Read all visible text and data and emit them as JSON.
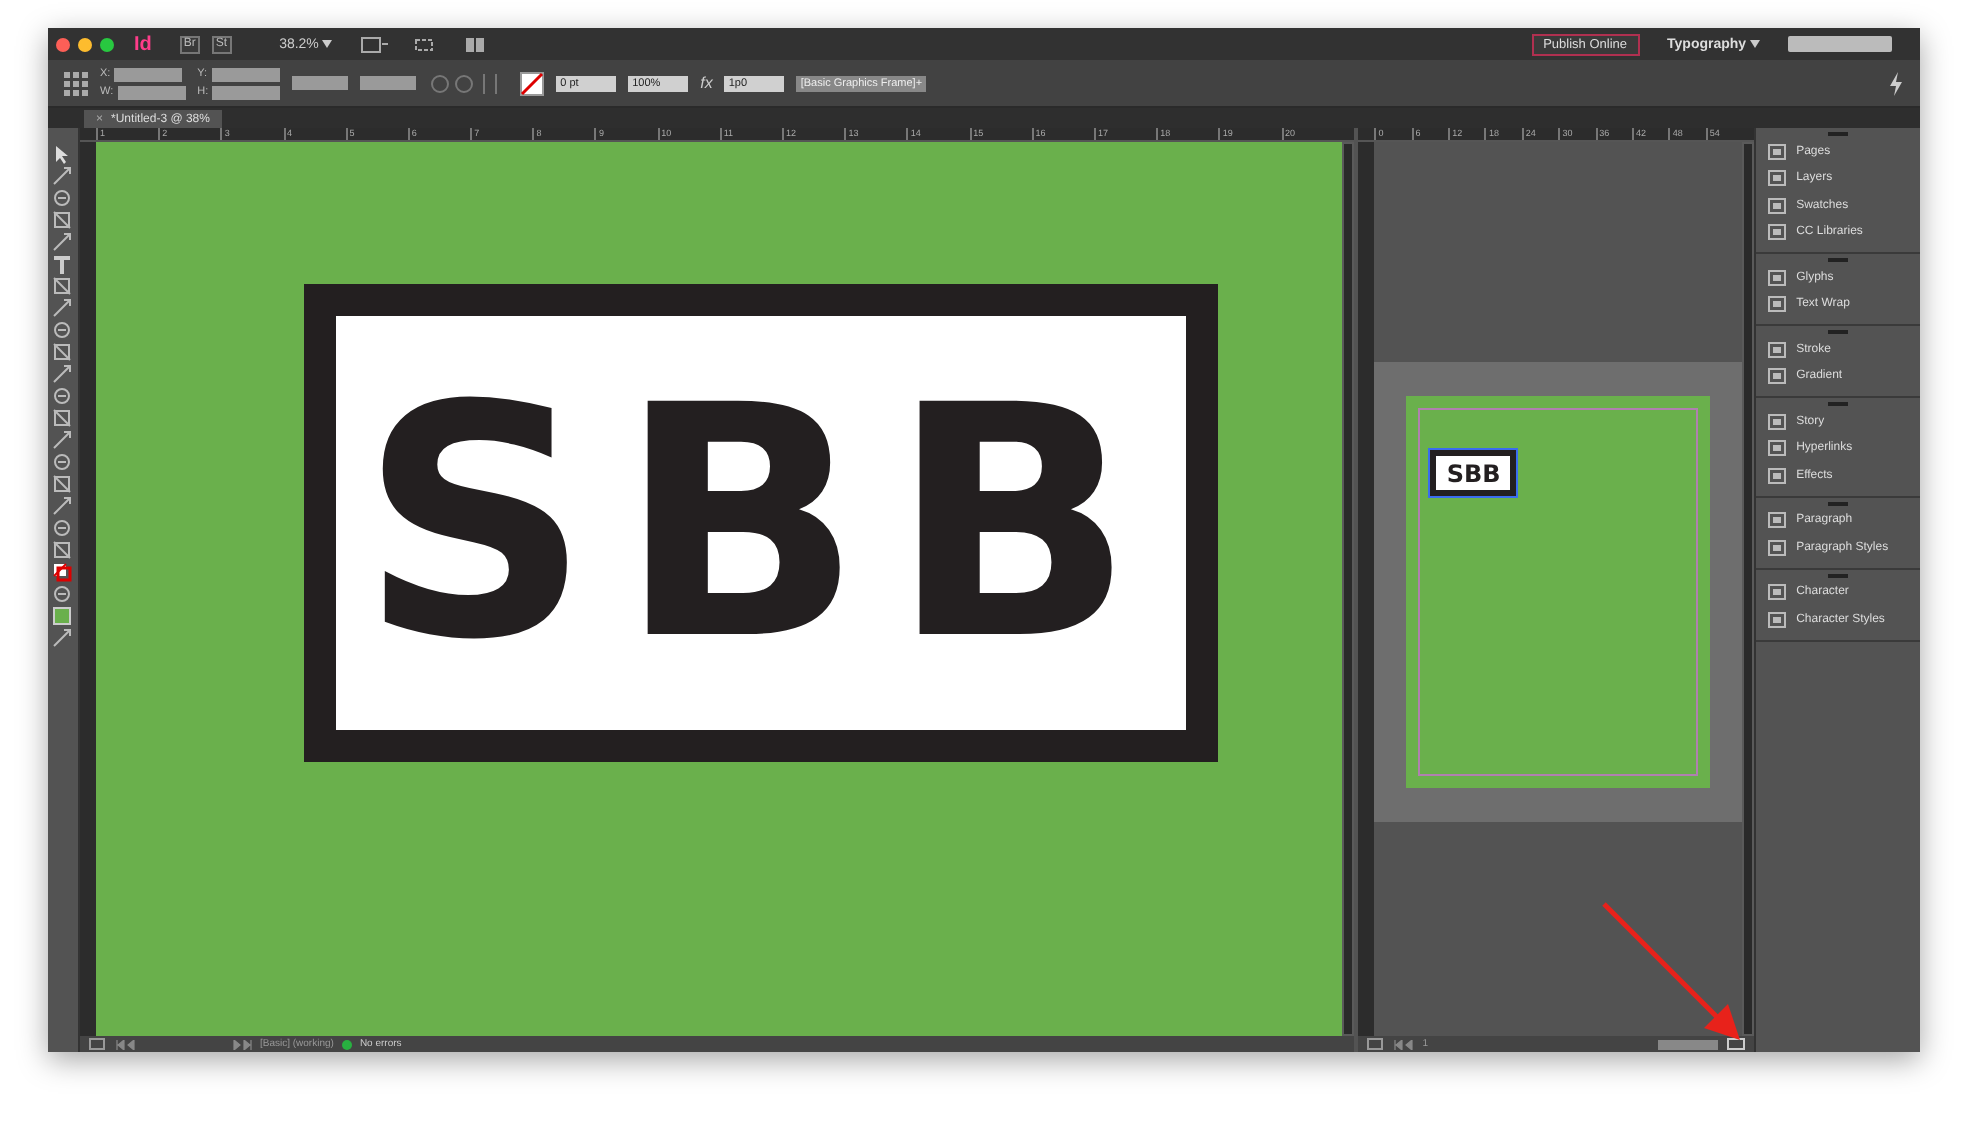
{
  "app_bar": {
    "logo": "Id",
    "buttons": [
      "Br",
      "St"
    ],
    "zoom": "38.2%",
    "publish_button": "Publish Online",
    "workspace": "Typography"
  },
  "control_bar": {
    "fields": [
      {
        "label": "X:"
      },
      {
        "label": "Y:"
      },
      {
        "label": "W:"
      },
      {
        "label": "H:"
      }
    ],
    "stroke_weight": "0 pt",
    "opacity": "100%",
    "fx": "fx",
    "offset": "1p0",
    "object_style": "[Basic Graphics Frame]+"
  },
  "document_tab": {
    "title": "*Untitled-3 @ 38%",
    "close": "×"
  },
  "main_view": {
    "ruler_numbers": [
      "1",
      "2",
      "3",
      "4",
      "5",
      "6",
      "7",
      "8",
      "9",
      "10",
      "11",
      "12",
      "13",
      "14",
      "15",
      "16",
      "17",
      "18",
      "19",
      "20"
    ],
    "artwork_text": "SBB",
    "preflight_profile": "[Basic] (working)",
    "preflight_status": "No errors"
  },
  "second_view": {
    "ruler_numbers": [
      "0",
      "6",
      "12",
      "18",
      "24",
      "30",
      "36",
      "42",
      "48",
      "54"
    ],
    "thumbnail_text": "SBB",
    "page_number": "1"
  },
  "panels": [
    [
      {
        "label": "Pages"
      },
      {
        "label": "Layers"
      },
      {
        "label": "Swatches"
      },
      {
        "label": "CC Libraries"
      }
    ],
    [
      {
        "label": "Glyphs"
      },
      {
        "label": "Text Wrap"
      }
    ],
    [
      {
        "label": "Stroke"
      },
      {
        "label": "Gradient"
      }
    ],
    [
      {
        "label": "Story"
      },
      {
        "label": "Hyperlinks"
      },
      {
        "label": "Effects"
      }
    ],
    [
      {
        "label": "Paragraph"
      },
      {
        "label": "Paragraph Styles"
      }
    ],
    [
      {
        "label": "Character"
      },
      {
        "label": "Character Styles"
      }
    ]
  ]
}
